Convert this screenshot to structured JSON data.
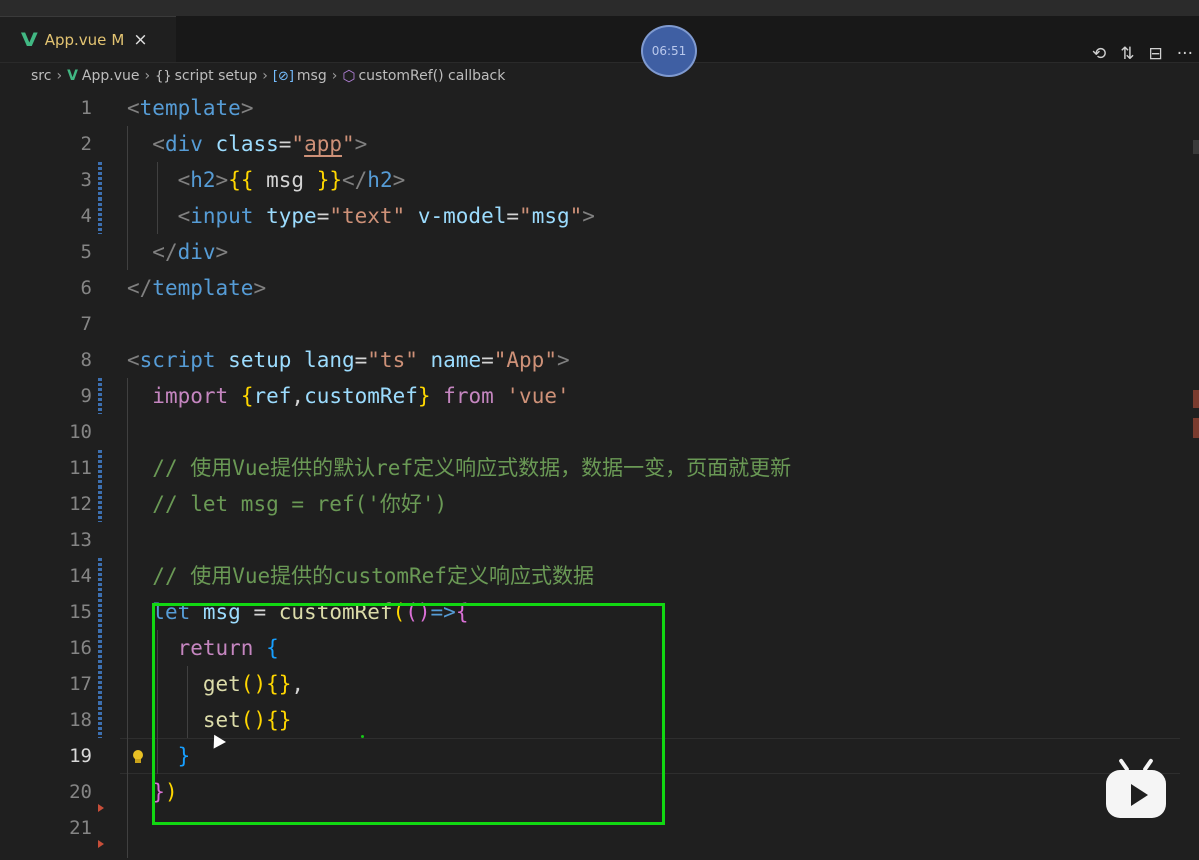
{
  "tab": {
    "icon": "vue-icon",
    "name": "App.vue",
    "modified": "M",
    "close": "×"
  },
  "timer": "06:51",
  "toolbar": [
    {
      "name": "timeline-icon",
      "glyph": "⟲"
    },
    {
      "name": "compare-icon",
      "glyph": "⇅"
    },
    {
      "name": "split-editor-icon",
      "glyph": "⊟"
    },
    {
      "name": "more-icon",
      "glyph": "···"
    }
  ],
  "breadcrumbs": {
    "folder": "src",
    "file": "App.vue",
    "block_symbol": "{}",
    "block": "script setup",
    "var_symbol": "[⊘]",
    "var": "msg",
    "fn_symbol": "⬡",
    "callback": "customRef() callback"
  },
  "active_line": 19,
  "lines": [
    {
      "n": "1",
      "tokens": [
        [
          "t-punc",
          "<"
        ],
        [
          "t-tag",
          "template"
        ],
        [
          "t-punc",
          ">"
        ]
      ]
    },
    {
      "n": "2",
      "tokens": [
        [
          "t-def",
          "  "
        ],
        [
          "t-punc",
          "<"
        ],
        [
          "t-tag",
          "div"
        ],
        [
          "t-def",
          " "
        ],
        [
          "t-attr",
          "class"
        ],
        [
          "t-op",
          "="
        ],
        [
          "t-str",
          "\""
        ],
        [
          "t-str u",
          "app"
        ],
        [
          "t-str",
          "\""
        ],
        [
          "t-punc",
          ">"
        ]
      ]
    },
    {
      "n": "3",
      "tokens": [
        [
          "t-def",
          "    "
        ],
        [
          "t-punc",
          "<"
        ],
        [
          "t-tag",
          "h2"
        ],
        [
          "t-punc",
          ">"
        ],
        [
          "t-br1",
          "{{"
        ],
        [
          "t-def",
          " msg "
        ],
        [
          "t-br1",
          "}}"
        ],
        [
          "t-punc",
          "</"
        ],
        [
          "t-tag",
          "h2"
        ],
        [
          "t-punc",
          ">"
        ]
      ]
    },
    {
      "n": "4",
      "tokens": [
        [
          "t-def",
          "    "
        ],
        [
          "t-punc",
          "<"
        ],
        [
          "t-tag",
          "input"
        ],
        [
          "t-def",
          " "
        ],
        [
          "t-attr",
          "type"
        ],
        [
          "t-op",
          "="
        ],
        [
          "t-str",
          "\"text\""
        ],
        [
          "t-def",
          " "
        ],
        [
          "t-attr",
          "v-model"
        ],
        [
          "t-op",
          "="
        ],
        [
          "t-str",
          "\""
        ],
        [
          "t-var",
          "msg"
        ],
        [
          "t-str",
          "\""
        ],
        [
          "t-punc",
          ">"
        ]
      ]
    },
    {
      "n": "5",
      "tokens": [
        [
          "t-def",
          "  "
        ],
        [
          "t-punc",
          "</"
        ],
        [
          "t-tag",
          "div"
        ],
        [
          "t-punc",
          ">"
        ]
      ]
    },
    {
      "n": "6",
      "tokens": [
        [
          "t-punc",
          "</"
        ],
        [
          "t-tag",
          "template"
        ],
        [
          "t-punc",
          ">"
        ]
      ]
    },
    {
      "n": "7",
      "tokens": []
    },
    {
      "n": "8",
      "tokens": [
        [
          "t-punc",
          "<"
        ],
        [
          "t-tag",
          "script"
        ],
        [
          "t-def",
          " "
        ],
        [
          "t-attr",
          "setup"
        ],
        [
          "t-def",
          " "
        ],
        [
          "t-attr",
          "lang"
        ],
        [
          "t-op",
          "="
        ],
        [
          "t-str",
          "\"ts\""
        ],
        [
          "t-def",
          " "
        ],
        [
          "t-attr",
          "name"
        ],
        [
          "t-op",
          "="
        ],
        [
          "t-str",
          "\"App\""
        ],
        [
          "t-punc",
          ">"
        ]
      ]
    },
    {
      "n": "9",
      "tokens": [
        [
          "t-def",
          "  "
        ],
        [
          "t-kw",
          "import"
        ],
        [
          "t-def",
          " "
        ],
        [
          "t-br1",
          "{"
        ],
        [
          "t-var",
          "ref"
        ],
        [
          "t-def",
          ","
        ],
        [
          "t-var",
          "customRef"
        ],
        [
          "t-br1",
          "}"
        ],
        [
          "t-def",
          " "
        ],
        [
          "t-kw",
          "from"
        ],
        [
          "t-def",
          " "
        ],
        [
          "t-str",
          "'vue'"
        ]
      ]
    },
    {
      "n": "10",
      "tokens": []
    },
    {
      "n": "11",
      "tokens": [
        [
          "t-def",
          "  "
        ],
        [
          "t-cm",
          "// 使用Vue提供的默认ref定义响应式数据，数据一变，页面就更新"
        ]
      ]
    },
    {
      "n": "12",
      "tokens": [
        [
          "t-def",
          "  "
        ],
        [
          "t-cm",
          "// let msg = ref('你好')"
        ]
      ]
    },
    {
      "n": "13",
      "tokens": []
    },
    {
      "n": "14",
      "tokens": [
        [
          "t-def",
          "  "
        ],
        [
          "t-cm",
          "// 使用Vue提供的customRef定义响应式数据"
        ]
      ]
    },
    {
      "n": "15",
      "tokens": [
        [
          "t-def",
          "  "
        ],
        [
          "t-kw2",
          "let"
        ],
        [
          "t-def",
          " "
        ],
        [
          "t-var",
          "msg"
        ],
        [
          "t-def",
          " = "
        ],
        [
          "t-fn",
          "customRef"
        ],
        [
          "t-br1",
          "("
        ],
        [
          "t-br2",
          "()"
        ],
        [
          "t-kw2",
          "=>"
        ],
        [
          "t-br2",
          "{"
        ]
      ]
    },
    {
      "n": "16",
      "tokens": [
        [
          "t-def",
          "    "
        ],
        [
          "t-kw",
          "return"
        ],
        [
          "t-def",
          " "
        ],
        [
          "t-br3",
          "{"
        ]
      ]
    },
    {
      "n": "17",
      "tokens": [
        [
          "t-def",
          "      "
        ],
        [
          "t-fn",
          "get"
        ],
        [
          "t-br1",
          "()"
        ],
        [
          "t-br1",
          "{}"
        ],
        [
          "t-def",
          ","
        ]
      ]
    },
    {
      "n": "18",
      "tokens": [
        [
          "t-def",
          "      "
        ],
        [
          "t-fn",
          "set"
        ],
        [
          "t-br1",
          "()"
        ],
        [
          "t-br1",
          "{}"
        ]
      ]
    },
    {
      "n": "19",
      "tokens": [
        [
          "t-def",
          "    "
        ],
        [
          "t-br3",
          "}"
        ]
      ]
    },
    {
      "n": "20",
      "tokens": [
        [
          "t-def",
          "  "
        ],
        [
          "t-br2",
          "}"
        ],
        [
          "t-br1",
          ")"
        ]
      ]
    },
    {
      "n": "21",
      "tokens": []
    }
  ],
  "modified_lines": [
    3,
    4,
    9,
    11,
    12,
    14,
    15,
    16,
    17,
    18
  ],
  "deleted_marks_after": [
    20,
    21
  ],
  "colors": {
    "highlight_box": "#12d812",
    "vue_green": "#41b883",
    "modified_tab": "#e3c472"
  }
}
